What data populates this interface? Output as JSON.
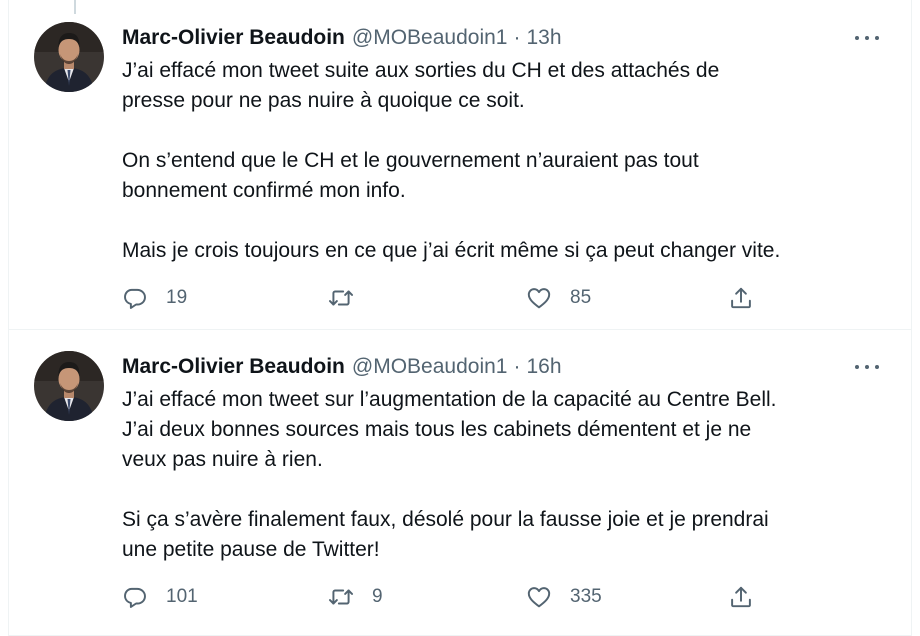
{
  "tweets": [
    {
      "author": {
        "name": "Marc-Olivier Beaudoin",
        "handle": "@MOBeaudoin1"
      },
      "separator": "·",
      "time": "13h",
      "paragraphs": [
        [
          "J’ai effacé mon tweet suite aux sorties du CH et des attachés de",
          "presse pour ne pas nuire à quoique ce soit."
        ],
        [
          "On s’entend que le CH et le gouvernement n’auraient pas tout",
          "bonnement confirmé mon info."
        ],
        [
          "Mais je crois toujours en ce que j’ai écrit même si ça peut changer vite."
        ]
      ],
      "actions": {
        "replies": "19",
        "retweets": "",
        "likes": "85"
      }
    },
    {
      "author": {
        "name": "Marc-Olivier Beaudoin",
        "handle": "@MOBeaudoin1"
      },
      "separator": "·",
      "time": "16h",
      "paragraphs": [
        [
          "J’ai effacé mon tweet sur l’augmentation de la capacité au Centre Bell.",
          "J’ai deux bonnes sources mais tous les cabinets démentent et je ne",
          "veux pas nuire à rien."
        ],
        [
          "Si ça s’avère finalement faux, désolé pour la fausse joie et je prendrai",
          "une petite pause de Twitter!"
        ]
      ],
      "actions": {
        "replies": "101",
        "retweets": "9",
        "likes": "335"
      }
    }
  ],
  "icons": {
    "more": "more-horizontal-icon",
    "reply": "reply-bubble-icon",
    "retweet": "retweet-arrows-icon",
    "like": "heart-icon",
    "share": "share-upload-icon"
  },
  "colors": {
    "text": "#0f1419",
    "secondary": "#536471",
    "border": "#eff3f4"
  }
}
